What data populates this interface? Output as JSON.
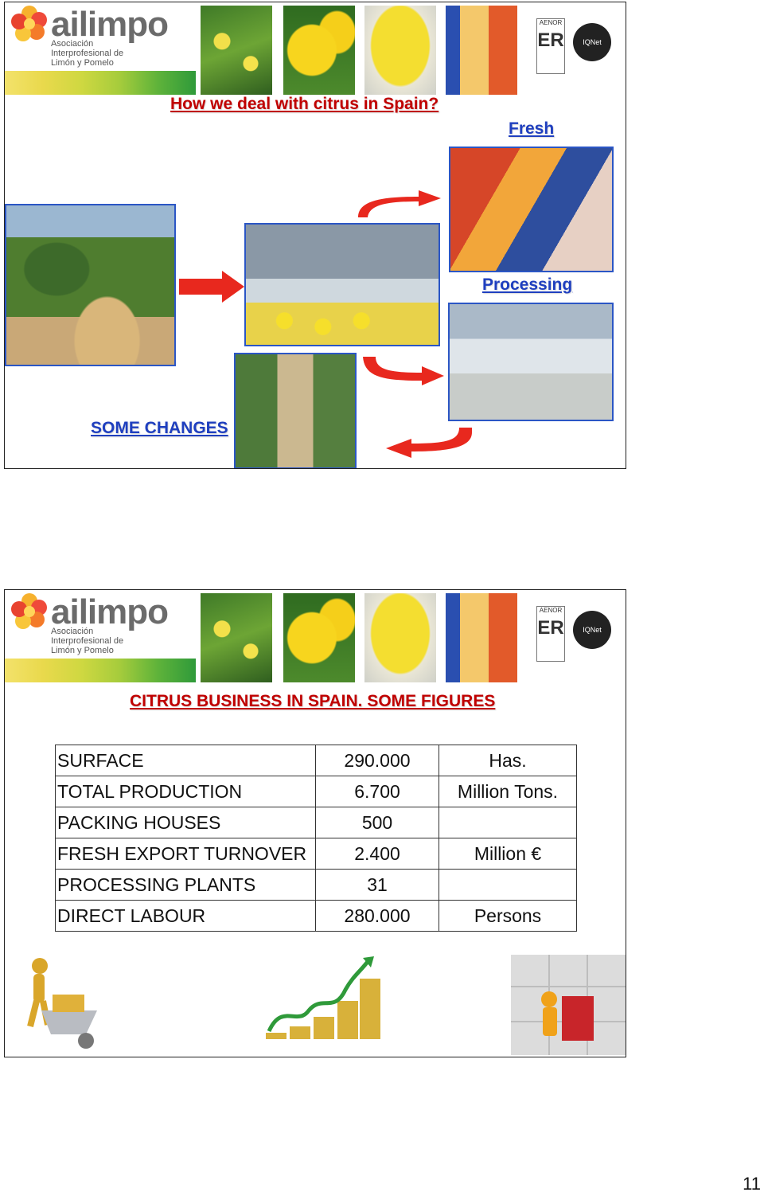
{
  "brand": {
    "name": "ailimpo",
    "subtitle": "Asociación\nInterprofesional de\nLimón y Pomelo",
    "certs": [
      "AENOR",
      "IQNet"
    ]
  },
  "slide1": {
    "title": "How we deal with citrus in Spain?",
    "label_fresh": "Fresh",
    "label_processing": "Processing",
    "label_changes": "SOME CHANGES"
  },
  "slide2": {
    "title": "CITRUS BUSINESS IN SPAIN. SOME FIGURES",
    "rows": [
      {
        "label": "SURFACE",
        "value": "290.000",
        "unit": "Has."
      },
      {
        "label": "TOTAL PRODUCTION",
        "value": "6.700",
        "unit": "Million Tons."
      },
      {
        "label": "PACKING HOUSES",
        "value": "500",
        "unit": ""
      },
      {
        "label": "FRESH EXPORT TURNOVER",
        "value": "2.400",
        "unit": "Million €"
      },
      {
        "label": "PROCESSING PLANTS",
        "value": "31",
        "unit": ""
      },
      {
        "label": "DIRECT LABOUR",
        "value": "280.000",
        "unit": "Persons"
      }
    ]
  },
  "page_number": "11",
  "colors": {
    "title_red": "#c00000",
    "link_blue": "#1f3fbf",
    "frame_blue": "#2b56c5",
    "arrow_red": "#e8281e"
  }
}
